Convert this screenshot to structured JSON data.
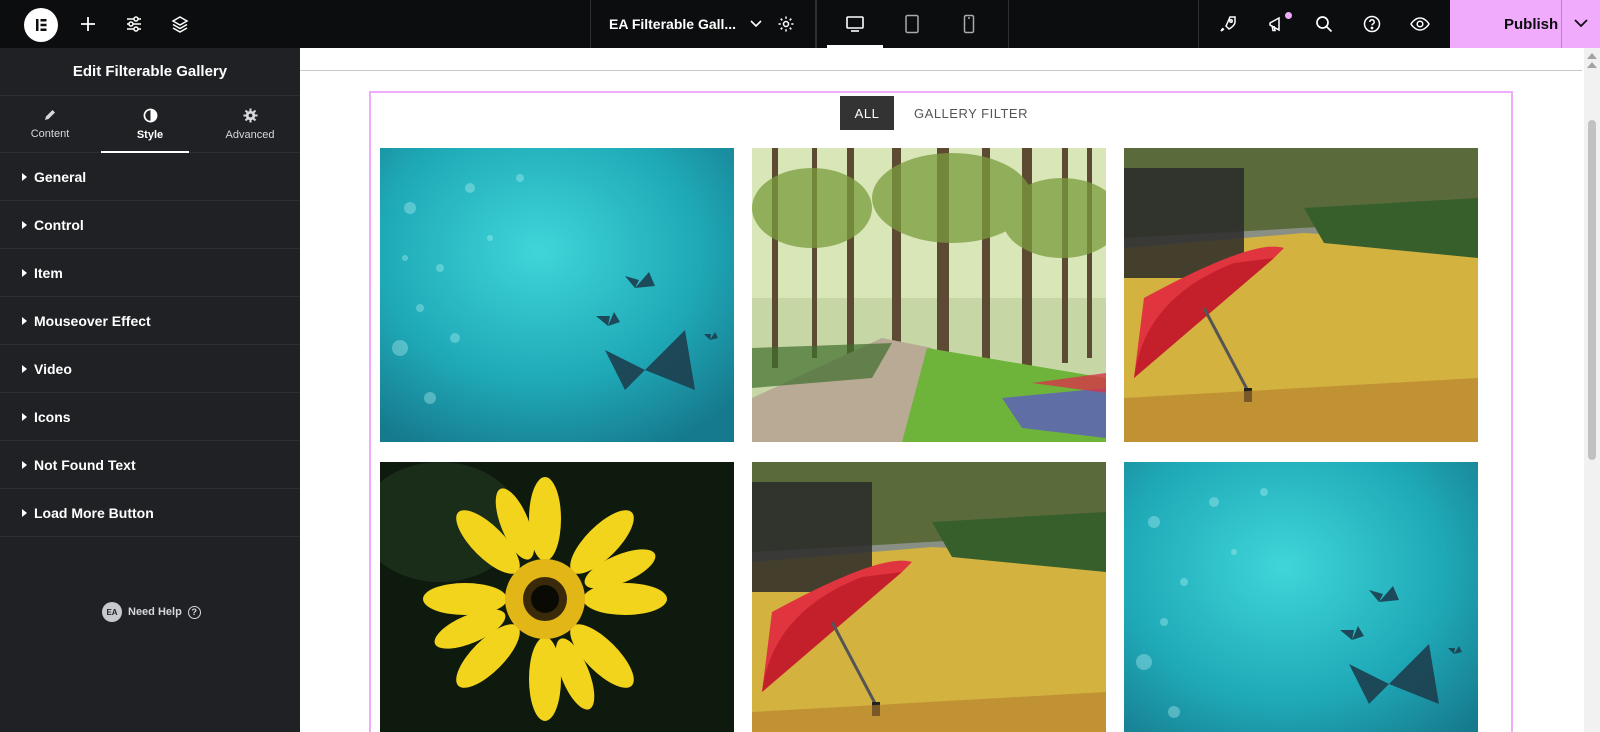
{
  "header": {
    "document_title": "EA Filterable Gall...",
    "publish_label": "Publish"
  },
  "sidebar": {
    "title": "Edit Filterable Gallery",
    "tabs": [
      {
        "label": "Content",
        "icon": "pencil-icon"
      },
      {
        "label": "Style",
        "icon": "contrast-icon",
        "active": true
      },
      {
        "label": "Advanced",
        "icon": "gear-icon"
      }
    ],
    "sections": [
      {
        "label": "General"
      },
      {
        "label": "Control"
      },
      {
        "label": "Item"
      },
      {
        "label": "Mouseover Effect"
      },
      {
        "label": "Video"
      },
      {
        "label": "Icons"
      },
      {
        "label": "Not Found Text"
      },
      {
        "label": "Load More Button"
      }
    ],
    "help": {
      "badge": "EA",
      "label": "Need Help",
      "icon": "question-icon"
    }
  },
  "gallery": {
    "filters": [
      {
        "label": "ALL",
        "active": true
      },
      {
        "label": "GALLERY FILTER",
        "active": false
      }
    ],
    "images": [
      {
        "name": "teal-butterflies-image"
      },
      {
        "name": "park-trees-image"
      },
      {
        "name": "red-umbrella-leaves-image"
      },
      {
        "name": "yellow-gerbera-image"
      },
      {
        "name": "red-umbrella-leaves-image"
      },
      {
        "name": "teal-butterflies-image"
      }
    ]
  },
  "colors": {
    "accent": "#f0abfc",
    "topbar": "#0c0d0e",
    "sidebar": "#1f2124"
  }
}
